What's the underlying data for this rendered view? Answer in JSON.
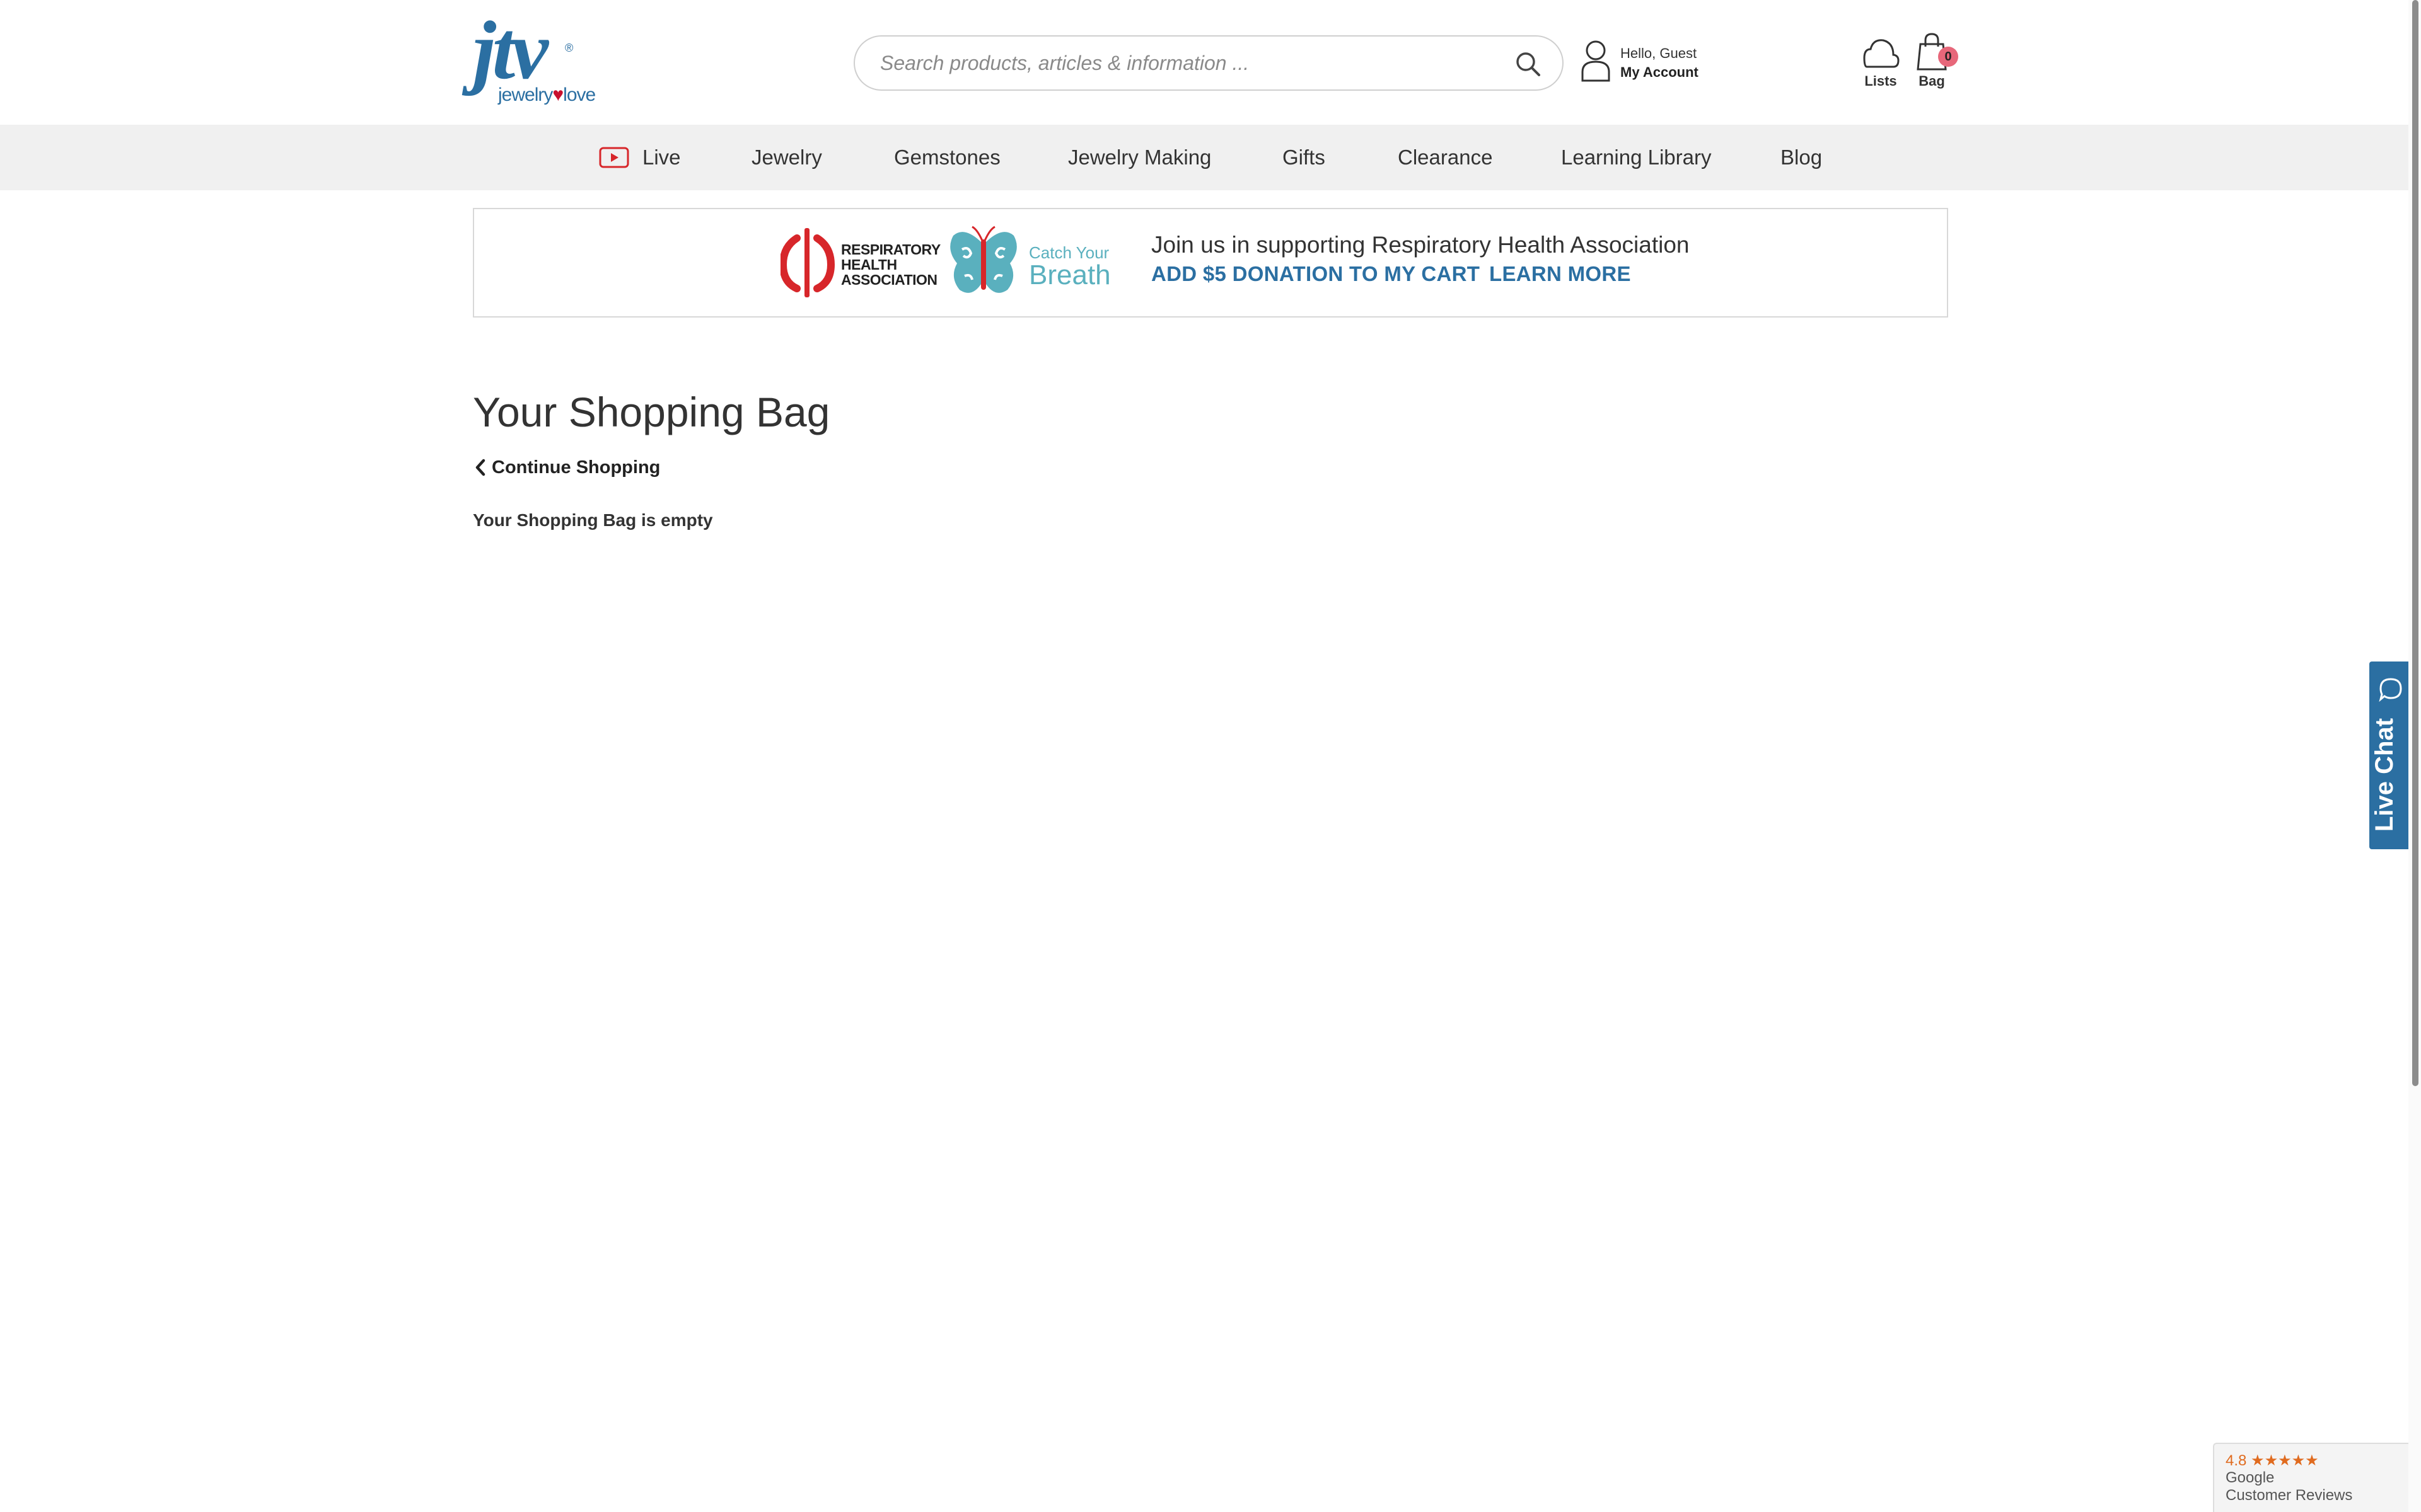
{
  "header": {
    "logo_text": "jtv",
    "logo_tagline_left": "jewelry",
    "logo_tagline_right": "love",
    "search_placeholder": "Search products, articles & information ...",
    "account_greeting": "Hello, Guest",
    "account_link": "My Account",
    "lists_label": "Lists",
    "bag_label": "Bag",
    "bag_count": "0"
  },
  "nav": {
    "items": [
      "Live",
      "Jewelry",
      "Gemstones",
      "Jewelry Making",
      "Gifts",
      "Clearance",
      "Learning Library",
      "Blog"
    ]
  },
  "banner": {
    "org_name_line1": "RESPIRATORY",
    "org_name_line2": "HEALTH",
    "org_name_line3": "ASSOCIATION",
    "campaign_line1": "Catch Your",
    "campaign_line2": "Breath",
    "headline": "Join us in supporting Respiratory Health Association",
    "donate_link": "ADD $5 DONATION TO MY CART",
    "learn_link": "LEARN MORE"
  },
  "main": {
    "title": "Your Shopping Bag",
    "continue_link": "Continue Shopping",
    "empty_message": "Your Shopping Bag is empty"
  },
  "live_chat": {
    "label": "Live Chat"
  },
  "google_reviews": {
    "rating": "4.8",
    "stars": "★★★★★",
    "brand": "Google",
    "label": "Customer Reviews"
  },
  "colors": {
    "brand_blue": "#2b6fa2",
    "nav_bg": "#f0f0f0",
    "bag_badge": "#e7677a",
    "rha_red": "#d7262a",
    "breath_teal": "#5ab0be"
  }
}
